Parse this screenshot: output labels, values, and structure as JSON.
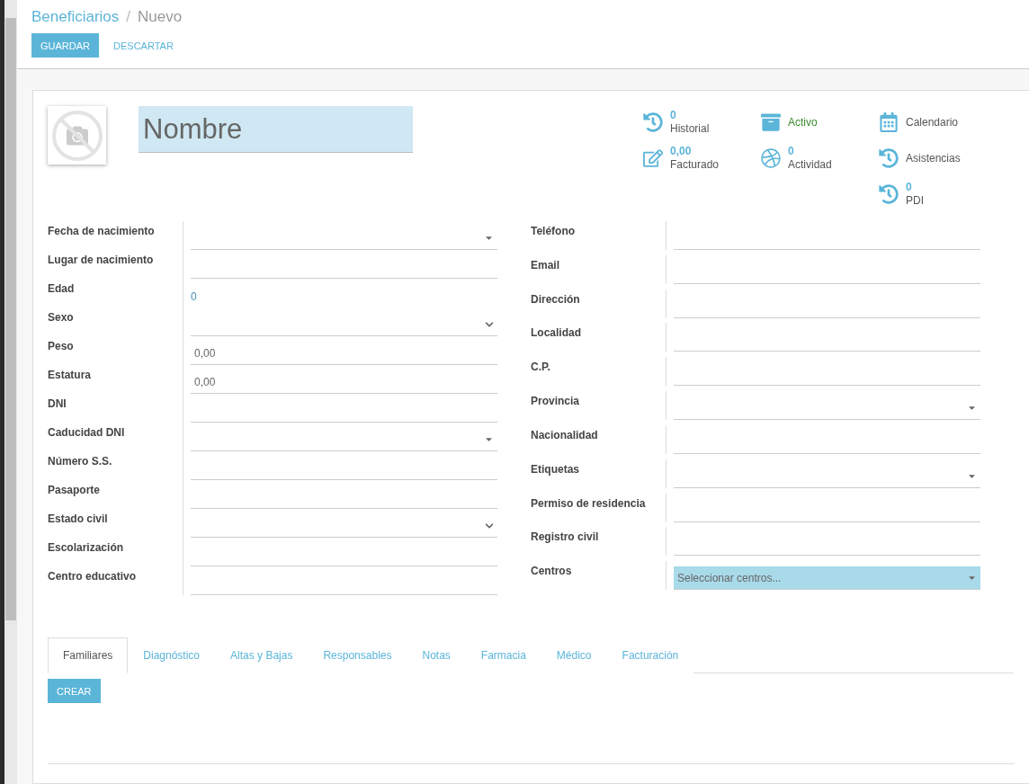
{
  "breadcrumb": {
    "parent": "Beneficiarios",
    "separator": "/",
    "current": "Nuevo"
  },
  "actions": {
    "save": "GUARDAR",
    "discard": "DESCARTAR"
  },
  "name_field": {
    "placeholder": "Nombre"
  },
  "stat_columns": [
    [
      {
        "kind": "history",
        "value": "0",
        "label": "Historial"
      },
      {
        "kind": "edit",
        "value": "0,00",
        "label": "Facturado"
      }
    ],
    [
      {
        "kind": "archive",
        "label": "Activo",
        "active": true
      },
      {
        "kind": "ball",
        "value": "0",
        "label": "Actividad"
      }
    ],
    [
      {
        "kind": "calendar",
        "label": "Calendario"
      },
      {
        "kind": "history",
        "label": "Asistencias"
      },
      {
        "kind": "history",
        "value": "0",
        "label": "PDI"
      }
    ]
  ],
  "left_fields": [
    {
      "label": "Fecha de nacimiento",
      "kind": "date"
    },
    {
      "label": "Lugar de nacimiento",
      "kind": "text"
    },
    {
      "label": "Edad",
      "kind": "readonly",
      "value": "0"
    },
    {
      "label": "Sexo",
      "kind": "select"
    },
    {
      "label": "Peso",
      "kind": "text",
      "value": "0,00"
    },
    {
      "label": "Estatura",
      "kind": "text",
      "value": "0,00"
    },
    {
      "label": "DNI",
      "kind": "text"
    },
    {
      "label": "Caducidad DNI",
      "kind": "date"
    },
    {
      "label": "Número S.S.",
      "kind": "text"
    },
    {
      "label": "Pasaporte",
      "kind": "text"
    },
    {
      "label": "Estado civil",
      "kind": "select"
    },
    {
      "label": "Escolarización",
      "kind": "text"
    },
    {
      "label": "Centro educativo",
      "kind": "text"
    }
  ],
  "right_fields": [
    {
      "label": "Teléfono",
      "kind": "text"
    },
    {
      "label": "Email",
      "kind": "text"
    },
    {
      "label": "Dirección",
      "kind": "text"
    },
    {
      "label": "Localidad",
      "kind": "text"
    },
    {
      "label": "C.P.",
      "kind": "text"
    },
    {
      "label": "Provincia",
      "kind": "date"
    },
    {
      "label": "Nacionalidad",
      "kind": "text"
    },
    {
      "label": "Etiquetas",
      "kind": "date"
    },
    {
      "label": "Permiso de residencia",
      "kind": "text"
    },
    {
      "label": "Registro civil",
      "kind": "text"
    },
    {
      "label": "Centros",
      "kind": "tags",
      "placeholder": "Seleccionar centros..."
    }
  ],
  "tabs": [
    {
      "label": "Familiares",
      "selected": true
    },
    {
      "label": "Diagnóstico",
      "selected": false
    },
    {
      "label": "Altas y Bajas",
      "selected": false
    },
    {
      "label": "Responsables",
      "selected": false
    },
    {
      "label": "Notas",
      "selected": false
    },
    {
      "label": "Farmacia",
      "selected": false
    },
    {
      "label": "Médico",
      "selected": false
    },
    {
      "label": "Facturación",
      "selected": false
    }
  ],
  "create_button": "CREAR"
}
